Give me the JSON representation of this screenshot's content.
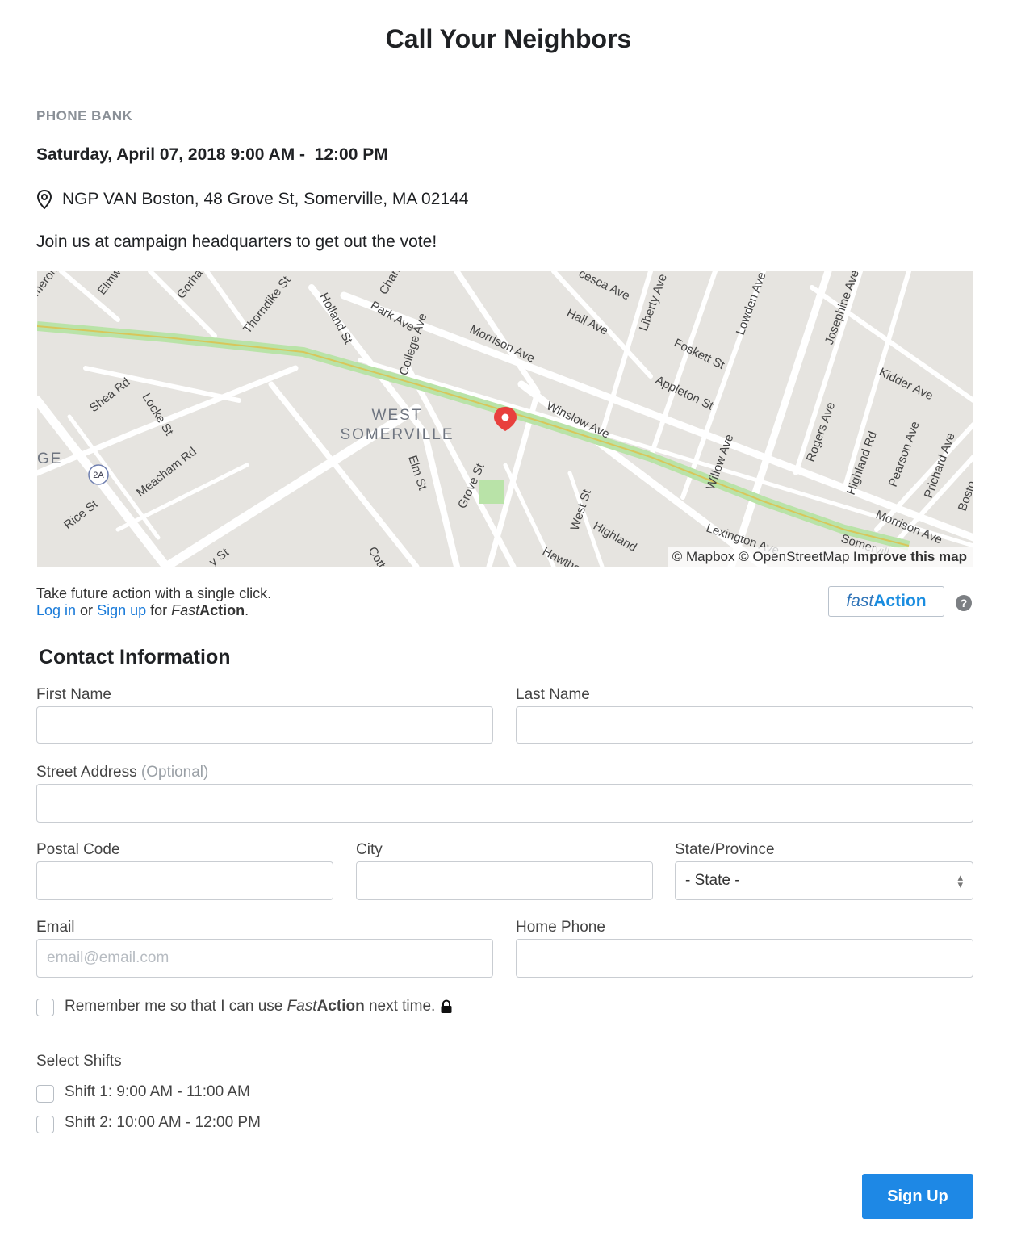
{
  "page": {
    "title": "Call Your Neighbors"
  },
  "event": {
    "type": "PHONE BANK",
    "datetime": "Saturday, April 07, 2018 9:00 AM -  12:00 PM",
    "location": "NGP VAN Boston, 48 Grove St, Somerville, MA 02144",
    "description": "Join us at campaign headquarters to get out the vote!"
  },
  "map": {
    "neighborhood_line1": "WEST",
    "neighborhood_line2": "SOMERVILLE",
    "edge_label": "GE",
    "route_shield": "2A",
    "streets": [
      "Holland St",
      "College Ave",
      "Park Ave",
      "Morrison Ave",
      "Hall Ave",
      "Liberty Ave",
      "Lowden Ave",
      "Josephine Ave",
      "Foskett St",
      "Appleton St",
      "Kidder Ave",
      "Winslow Ave",
      "Willow Ave",
      "Rogers Ave",
      "Highland Rd",
      "Pearson Ave",
      "Prichard Ave",
      "Bosto",
      "Morrison Ave",
      "Lexington Ave",
      "Somervill",
      "Highland",
      "West St",
      "Grove St",
      "Elm St",
      "Hawtho",
      "Cott",
      "Rice St",
      "Meacham Rd",
      "Locke St",
      "Shea Rd",
      "Thorndike St",
      "Gorha",
      "Elmw",
      "meron",
      "Chan",
      "cesca Ave",
      "y St"
    ],
    "attribution": {
      "mapbox": "© Mapbox",
      "osm": "© OpenStreetMap",
      "improve": "Improve this map"
    },
    "marker_color": "#e8403d"
  },
  "fastaction": {
    "prompt": "Take future action with a single click.",
    "login": "Log in",
    "or": " or ",
    "signup": "Sign up",
    "for": " for ",
    "fast": "Fast",
    "action": "Action",
    "period": ".",
    "logo_fast": "fast",
    "logo_action": "Action",
    "help": "?"
  },
  "contact": {
    "title": "Contact Information",
    "first_name_label": "First Name",
    "last_name_label": "Last Name",
    "street_label": "Street Address",
    "street_optional": "(Optional)",
    "postal_label": "Postal Code",
    "city_label": "City",
    "state_label": "State/Province",
    "state_value": "- State -",
    "email_label": "Email",
    "email_placeholder": "email@email.com",
    "phone_label": "Home Phone",
    "remember_pre": "Remember me so that I can use ",
    "remember_fast": "Fast",
    "remember_action": "Action",
    "remember_post": " next time."
  },
  "shifts": {
    "label": "Select Shifts",
    "items": [
      "Shift 1: 9:00 AM - 11:00 AM",
      "Shift 2: 10:00 AM - 12:00 PM"
    ]
  },
  "submit": {
    "label": "Sign Up"
  },
  "colors": {
    "accent": "#1e88e5",
    "link": "#1a7bd9"
  }
}
